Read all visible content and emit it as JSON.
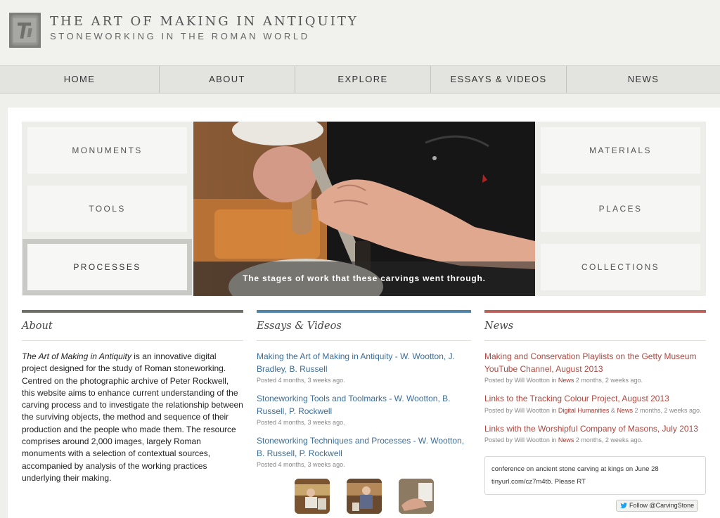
{
  "header": {
    "title": "THE ART OF MAKING IN ANTIQUITY",
    "subtitle": "STONEWORKING IN THE ROMAN WORLD"
  },
  "nav": [
    "HOME",
    "ABOUT",
    "EXPLORE",
    "ESSAYS & VIDEOS",
    "NEWS"
  ],
  "tiles_left": [
    "MONUMENTS",
    "TOOLS",
    "PROCESSES"
  ],
  "tiles_right": [
    "MATERIALS",
    "PLACES",
    "COLLECTIONS"
  ],
  "active_tile": "PROCESSES",
  "hero": {
    "caption": "The stages of work that these carvings went through."
  },
  "about": {
    "heading": "About",
    "italic_lead": "The Art of Making in Antiquity",
    "text": " is an innovative digital project designed for the study of Roman stoneworking. Centred on the photographic archive of Peter Rockwell, this website aims to enhance current understanding of the carving process and to investigate the relationship between the surviving objects, the method and sequence of their production and the people who made them. The resource comprises around 2,000 images, largely Roman monuments with a selection of contextual sources, accompanied by analysis of the working practices underlying their making."
  },
  "essays": {
    "heading": "Essays & Videos",
    "posts": [
      {
        "title": "Making the Art of Making in Antiquity - W. Wootton, J. Bradley, B. Russell",
        "meta": "Posted 4 months, 3 weeks ago."
      },
      {
        "title": "Stoneworking Tools and Toolmarks - W. Wootton, B. Russell, P. Rockwell",
        "meta": "Posted 4 months, 3 weeks ago."
      },
      {
        "title": "Stoneworking Techniques and Processes - W. Wootton, B. Russell, P. Rockwell",
        "meta": "Posted 4 months, 3 weeks ago."
      }
    ]
  },
  "news": {
    "heading": "News",
    "posts": [
      {
        "title": "Making and Conservation Playlists on the Getty Museum YouTube Channel, August 2013",
        "meta_pre": "Posted by Will Wootton in ",
        "cats": [
          "News"
        ],
        "meta_post": " 2 months, 2 weeks ago."
      },
      {
        "title": "Links to the Tracking Colour Project, August 2013",
        "meta_pre": "Posted by Will Wootton in ",
        "cats": [
          "Digital Humanities",
          "News"
        ],
        "meta_post": " 2 months, 2 weeks ago."
      },
      {
        "title": "Links with the Worshipful Company of Masons, July 2013",
        "meta_pre": "Posted by Will Wootton in ",
        "cats": [
          "News"
        ],
        "meta_post": " 2 months, 2 weeks ago."
      }
    ],
    "tweet_line1": "conference on ancient stone carving at kings on June 28",
    "tweet_line2": "tinyurl.com/cz7m4tb. Please RT",
    "follow_label": "Follow @CarvingStone"
  },
  "colors": {
    "about_rule": "#6f6f68",
    "essays_rule": "#4f84a8",
    "news_rule": "#b9605a",
    "twitter_blue": "#1da1f2"
  }
}
